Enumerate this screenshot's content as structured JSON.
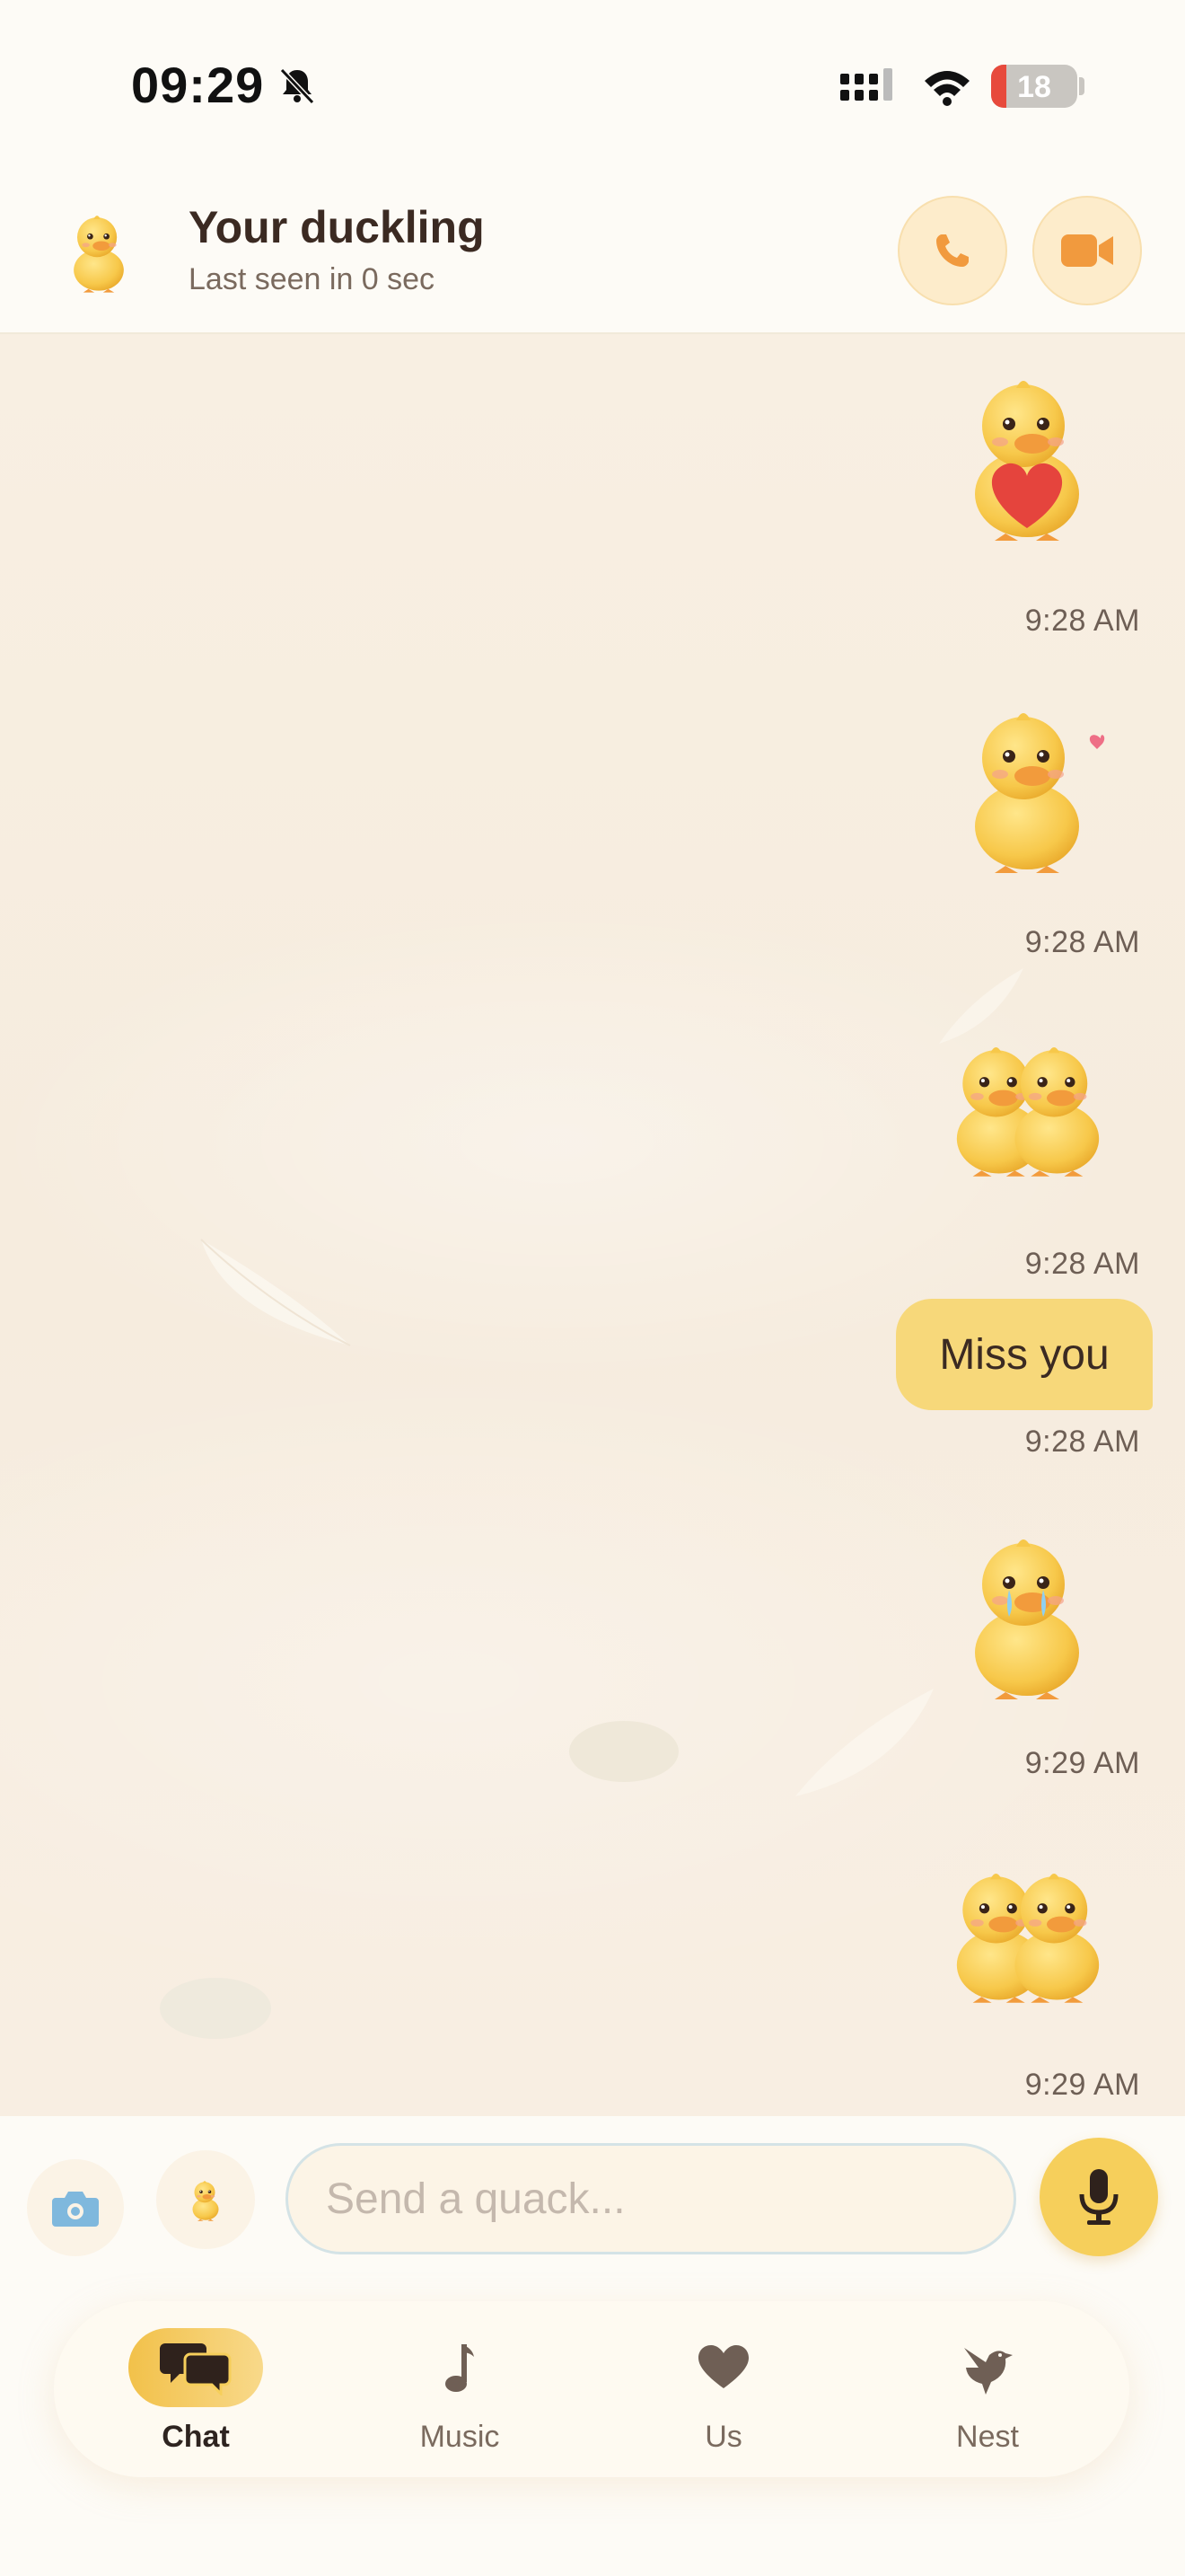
{
  "status_bar": {
    "time": "09:29",
    "battery": "18",
    "battery_level": 0.18
  },
  "header": {
    "contact_name": "Your duckling",
    "contact_status": "Last seen in 0 sec"
  },
  "messages": [
    {
      "kind": "sticker",
      "sticker": "duckling-holding-heart",
      "time": "9:28 AM"
    },
    {
      "kind": "sticker",
      "sticker": "duckling-blowing-kiss",
      "time": "9:28 AM"
    },
    {
      "kind": "sticker",
      "sticker": "two-ducklings-hugging",
      "time": "9:28 AM"
    },
    {
      "kind": "text",
      "text": "Miss you",
      "time": "9:28 AM"
    },
    {
      "kind": "sticker",
      "sticker": "crying-duckling",
      "time": "9:29 AM"
    },
    {
      "kind": "sticker",
      "sticker": "two-ducklings-hugging",
      "time": "9:29 AM"
    }
  ],
  "composer": {
    "placeholder": "Send a quack..."
  },
  "nav": {
    "items": [
      {
        "label": "Chat",
        "icon": "chat-bubbles-icon",
        "active": true
      },
      {
        "label": "Music",
        "icon": "music-note-icon",
        "active": false
      },
      {
        "label": "Us",
        "icon": "heart-icon",
        "active": false
      },
      {
        "label": "Nest",
        "icon": "bird-icon",
        "active": false
      }
    ]
  },
  "colors": {
    "accent": "#F6CF5B",
    "bubble": "#F7D87A",
    "chat_background": "#F7EDE0",
    "icon_orange": "#F19A3E",
    "text_dark": "#3B2A22",
    "text_muted": "#7A6A5E"
  }
}
